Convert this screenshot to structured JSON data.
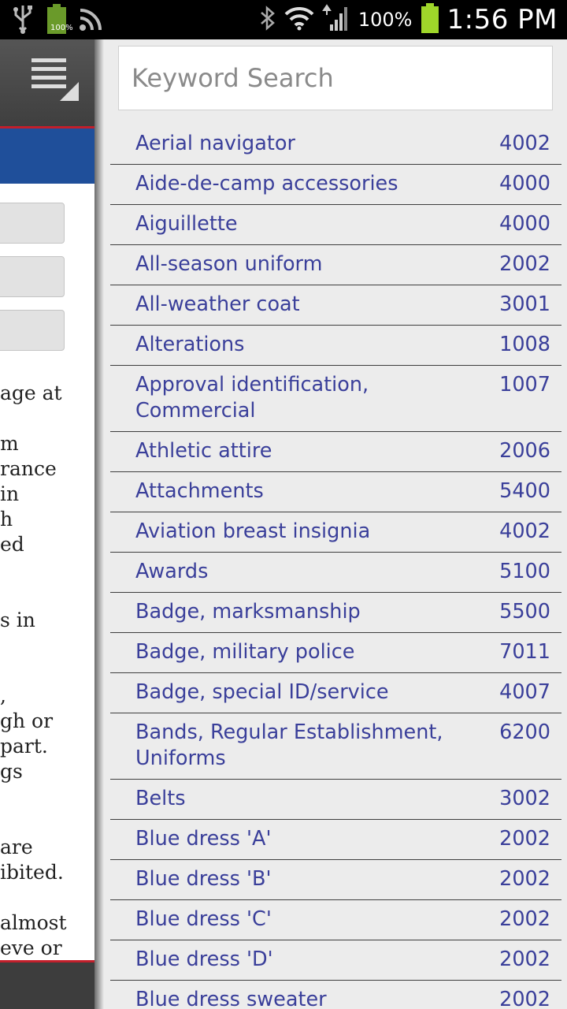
{
  "status_bar": {
    "battery_small_pct": "100%",
    "battery_pct": "100%",
    "time": "1:56 PM",
    "icons": [
      "usb-icon",
      "battery-icon",
      "rss-icon",
      "bluetooth-icon",
      "wifi-icon",
      "signal-icon",
      "battery-charging-icon"
    ]
  },
  "left_page": {
    "text_fragments": "age at\n\nm\nrance\nin\nh\ned\n\n\ns in\n\n\n,\ngh or\npart.\ngs\n\n\nare\nibited.\n\nalmost\neve or"
  },
  "search": {
    "placeholder": "Keyword Search",
    "value": ""
  },
  "index": [
    {
      "term": "Aerial navigator",
      "code": "4002"
    },
    {
      "term": "Aide-de-camp accessories",
      "code": "4000"
    },
    {
      "term": "Aiguillette",
      "code": "4000"
    },
    {
      "term": "All-season uniform",
      "code": "2002"
    },
    {
      "term": "All-weather coat",
      "code": "3001"
    },
    {
      "term": "Alterations",
      "code": "1008"
    },
    {
      "term": "Approval identification, Commercial",
      "code": "1007"
    },
    {
      "term": "Athletic attire",
      "code": "2006"
    },
    {
      "term": "Attachments",
      "code": "5400"
    },
    {
      "term": "Aviation breast insignia",
      "code": "4002"
    },
    {
      "term": "Awards",
      "code": "5100"
    },
    {
      "term": "Badge, marksmanship",
      "code": "5500"
    },
    {
      "term": "Badge, military police",
      "code": "7011"
    },
    {
      "term": "Badge, special ID/service",
      "code": "4007"
    },
    {
      "term": "Bands, Regular Establishment, Uniforms",
      "code": "6200"
    },
    {
      "term": "Belts",
      "code": "3002"
    },
    {
      "term": "Blue dress 'A'",
      "code": "2002"
    },
    {
      "term": "Blue dress 'B'",
      "code": "2002"
    },
    {
      "term": "Blue dress 'C'",
      "code": "2002"
    },
    {
      "term": "Blue dress 'D'",
      "code": "2002"
    },
    {
      "term": "Blue dress sweater",
      "code": "2002"
    }
  ],
  "colors": {
    "link": "#3a3f9a",
    "accent_red": "#c21f2b",
    "banner_blue": "#1f4f9a",
    "list_bg": "#ececec"
  }
}
